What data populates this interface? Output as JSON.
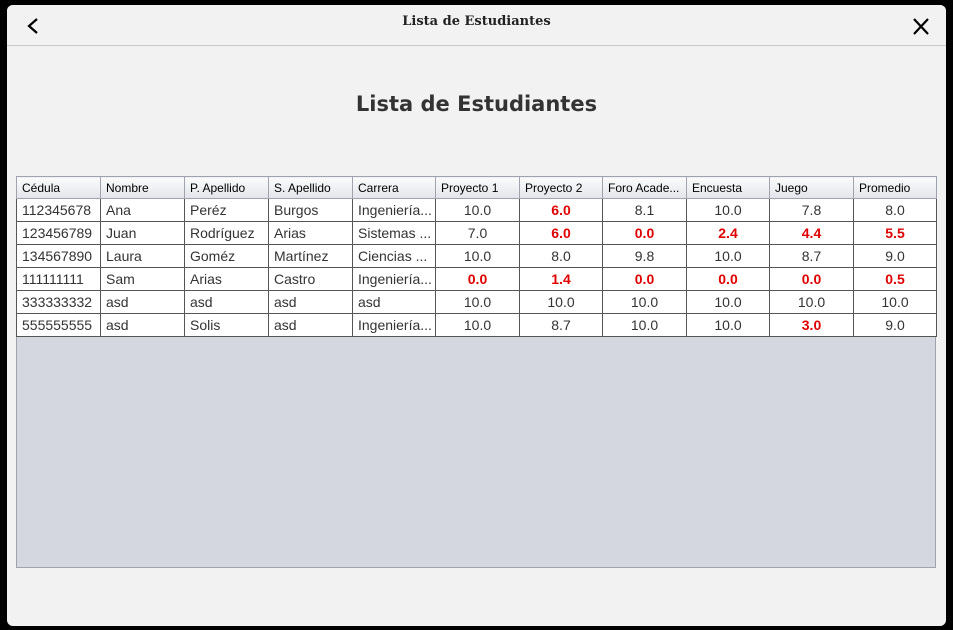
{
  "window": {
    "title": "Lista de Estudiantes"
  },
  "page_title": "Lista de Estudiantes",
  "colors": {
    "failing": "#e00000"
  },
  "table": {
    "columns": [
      "Cédula",
      "Nombre",
      "P. Apellido",
      "S. Apellido",
      "Carrera",
      "Proyecto 1",
      "Proyecto 2",
      "Foro Acade...",
      "Encuesta",
      "Juego",
      "Promedio"
    ],
    "rows": [
      [
        "112345678",
        "Ana",
        "Peréz",
        "Burgos",
        "Ingeniería...",
        "10.0",
        "6.0",
        "8.1",
        "10.0",
        "7.8",
        "8.0"
      ],
      [
        "123456789",
        "Juan",
        "Rodríguez",
        "Arias",
        "Sistemas ...",
        "7.0",
        "6.0",
        "0.0",
        "2.4",
        "4.4",
        "5.5"
      ],
      [
        "134567890",
        "Laura",
        "Goméz",
        "Martínez",
        "Ciencias ...",
        "10.0",
        "8.0",
        "9.8",
        "10.0",
        "8.7",
        "9.0"
      ],
      [
        "111111111",
        "Sam",
        "Arias",
        "Castro",
        "Ingeniería...",
        "0.0",
        "1.4",
        "0.0",
        "0.0",
        "0.0",
        "0.5"
      ],
      [
        "333333332",
        "asd",
        "asd",
        "asd",
        "asd",
        "10.0",
        "10.0",
        "10.0",
        "10.0",
        "10.0",
        "10.0"
      ],
      [
        "555555555",
        "asd",
        "Solis",
        "asd",
        "Ingeniería...",
        "10.0",
        "8.7",
        "10.0",
        "10.0",
        "3.0",
        "9.0"
      ]
    ]
  }
}
